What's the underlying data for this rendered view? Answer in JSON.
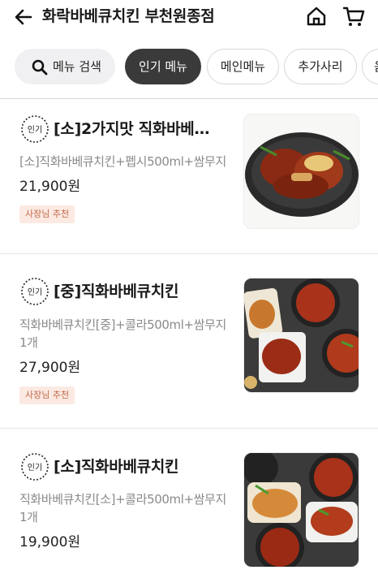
{
  "header": {
    "store_name": "화락바베큐치킨 부천원종점"
  },
  "tabs": {
    "search_label": "메뉴 검색",
    "items": [
      {
        "label": "인기 메뉴",
        "active": true
      },
      {
        "label": "메인메뉴",
        "active": false
      },
      {
        "label": "추가사리",
        "active": false
      },
      {
        "label": "음",
        "active": false
      }
    ]
  },
  "menu": [
    {
      "badge": "인기",
      "name": "[소]2가지맛 직화바베…",
      "description": "[소]직화바베큐치킨+펩시500ml+쌈무지",
      "price": "21,900원",
      "tag": "사장님 추천"
    },
    {
      "badge": "인기",
      "name": "[중]직화바베큐치킨",
      "description": "직화바베큐치킨[중]+콜라500ml+쌈무지1개",
      "price": "27,900원",
      "tag": "사장님 추천"
    },
    {
      "badge": "인기",
      "name": "[소]직화바베큐치킨",
      "description": "직화바베큐치킨[소]+콜라500ml+쌈무지1개",
      "price": "19,900원",
      "tag": ""
    }
  ],
  "colors": {
    "active_chip_bg": "#3a3a3a",
    "tag_bg": "#fbe9e2",
    "tag_text": "#c36a4a"
  },
  "icons": [
    "back-arrow-icon",
    "home-icon",
    "cart-icon",
    "search-icon",
    "popular-badge-icon"
  ]
}
